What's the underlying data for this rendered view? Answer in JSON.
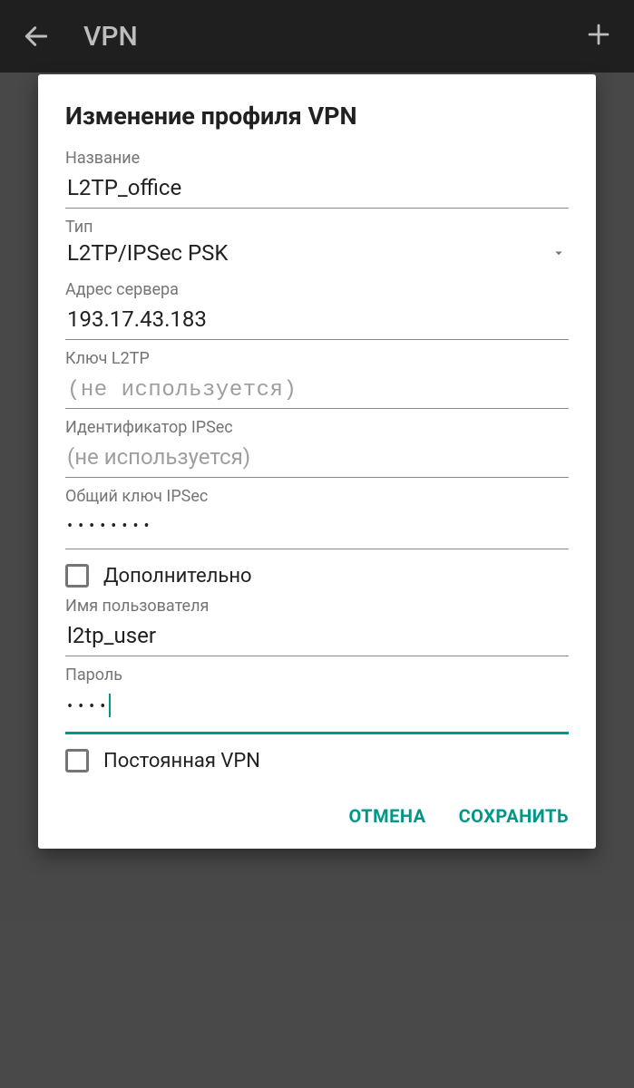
{
  "appbar": {
    "title": "VPN"
  },
  "dialog": {
    "title": "Изменение профиля VPN",
    "name_label": "Название",
    "name_value": "L2TP_office",
    "type_label": "Тип",
    "type_value": "L2TP/IPSec PSK",
    "server_label": "Адрес сервера",
    "server_value": "193.17.43.183",
    "l2tp_key_label": "Ключ L2TP",
    "l2tp_key_placeholder": "(не используется)",
    "ipsec_id_label": "Идентификатор IPSec",
    "ipsec_id_placeholder": "(не используется)",
    "ipsec_psk_label": "Общий ключ IPSec",
    "ipsec_psk_masked": "••••••••",
    "advanced_label": "Дополнительно",
    "username_label": "Имя пользователя",
    "username_value": "l2tp_user",
    "password_label": "Пароль",
    "password_masked": "••••",
    "always_on_label": "Постоянная VPN",
    "cancel": "ОТМЕНА",
    "save": "СОХРАНИТЬ"
  }
}
